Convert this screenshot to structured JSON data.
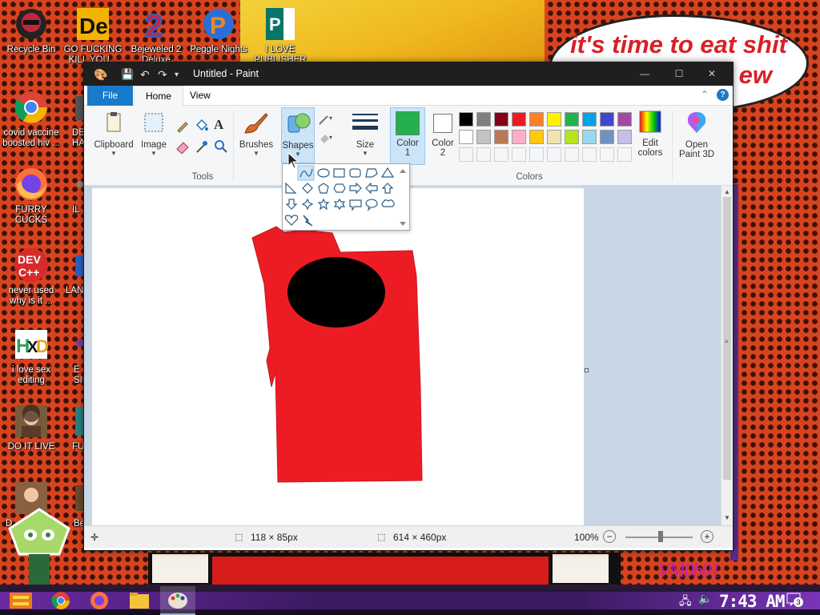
{
  "desktop": {
    "wallpaper_text": [
      "it's time to eat shit",
      "ew"
    ],
    "signature": "VM0b01",
    "icons": [
      {
        "name": "recycle-bin",
        "label": "Recycle Bin"
      },
      {
        "name": "go-fucking-kill",
        "label": "GO FUCKING\nKILL YOU..."
      },
      {
        "name": "bejeweled-2",
        "label": "Bejeweled 2\nDeluxe"
      },
      {
        "name": "peggle-nights",
        "label": "Peggle Nights"
      },
      {
        "name": "i-love",
        "label": "I LOVE\nPUBLISHER"
      },
      {
        "name": "covid-vaccine",
        "label": "covid vaccine\nboosted hiv ..."
      },
      {
        "name": "de-ha",
        "label": "DE\nHA"
      },
      {
        "name": "furry-cucks",
        "label": "FURRY CUCKS"
      },
      {
        "name": "il",
        "label": "IL"
      },
      {
        "name": "never-used",
        "label": "never used\nwhy is it ..."
      },
      {
        "name": "lan",
        "label": "LAN"
      },
      {
        "name": "i-love-sex-editing",
        "label": "i love sex\nediting"
      },
      {
        "name": "e-sin",
        "label": "E\nSIN"
      },
      {
        "name": "do-it-live",
        "label": "DO IT LIVE"
      },
      {
        "name": "fu",
        "label": "FU"
      },
      {
        "name": "d-small",
        "label": "D"
      },
      {
        "name": "be-small",
        "label": "Be"
      }
    ]
  },
  "paint": {
    "title": "Untitled - Paint",
    "tabs": {
      "file": "File",
      "home": "Home",
      "view": "View"
    },
    "ribbon": {
      "clipboard": "Clipboard",
      "image": "Image",
      "tools": "Tools",
      "brushes": "Brushes",
      "shapes": "Shapes",
      "size": "Size",
      "color1_a": "Color",
      "color1_b": "1",
      "color2_a": "Color",
      "color2_b": "2",
      "colors": "Colors",
      "edit_colors_a": "Edit",
      "edit_colors_b": "colors",
      "open_paint3d_a": "Open",
      "open_paint3d_b": "Paint 3D"
    },
    "colors": {
      "color1": "#22b14c",
      "color2": "#ffffff",
      "palette_row1": [
        "#000000",
        "#7f7f7f",
        "#880015",
        "#ed1c24",
        "#ff7f27",
        "#fff200",
        "#22b14c",
        "#00a2e8",
        "#3f48cc",
        "#a349a4"
      ],
      "palette_row2": [
        "#ffffff",
        "#c3c3c3",
        "#b97a57",
        "#ffaec9",
        "#ffc90e",
        "#efe4b0",
        "#b5e61d",
        "#99d9ea",
        "#7092be",
        "#c8bfe7"
      ]
    },
    "drawing": {
      "body_color": "#ed1c24",
      "eye_color": "#000000"
    },
    "status": {
      "selection_size": "118 × 85px",
      "canvas_size": "614 × 460px",
      "zoom": "100%"
    }
  },
  "taskbar": {
    "clock": "7:43 AM",
    "notification_count": "3"
  }
}
